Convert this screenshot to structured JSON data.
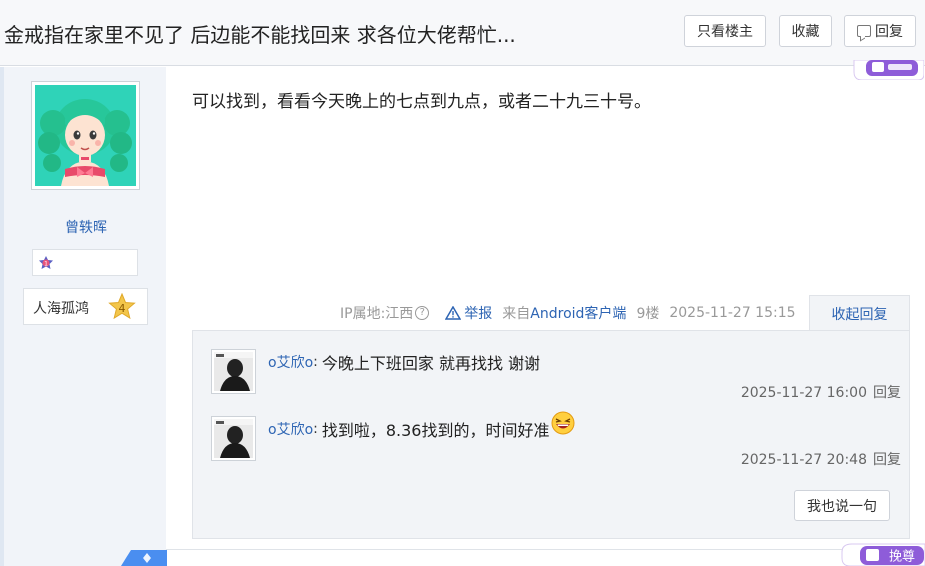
{
  "header": {
    "title": "金戒指在家里不见了 后边能不能找回来 求各位大佬帮忙...",
    "btn_only_op": "只看楼主",
    "btn_favorite": "收藏",
    "btn_reply": "回复"
  },
  "author": {
    "name": "曾轶晖",
    "level": "1",
    "group_name": "人海孤鸿",
    "group_level": "4"
  },
  "post": {
    "content": "可以找到，看看今天晚上的七点到九点，或者二十九三十号。",
    "ip_label": "IP属地:江西",
    "report": "举报",
    "from_prefix": "来自",
    "client": "Android客户端",
    "floor": "9楼",
    "time": "2025-11-27 15:15",
    "collapse": "收起回复",
    "badge_text": "挽尊"
  },
  "replies": [
    {
      "user": "o艾欣o",
      "text": "今晚上下班回家 就再找找 谢谢",
      "time": "2025-11-27 16:00",
      "reply": "回复"
    },
    {
      "user": "o艾欣o",
      "text": "找到啦，8.36找到的，时间好准",
      "time": "2025-11-27 20:48",
      "reply": "回复"
    }
  ],
  "say_button": "我也说一句",
  "colors": {
    "link": "#2d64b3",
    "badge_purple": "#8e5cd9",
    "panel_bg": "#f2f4f7"
  }
}
